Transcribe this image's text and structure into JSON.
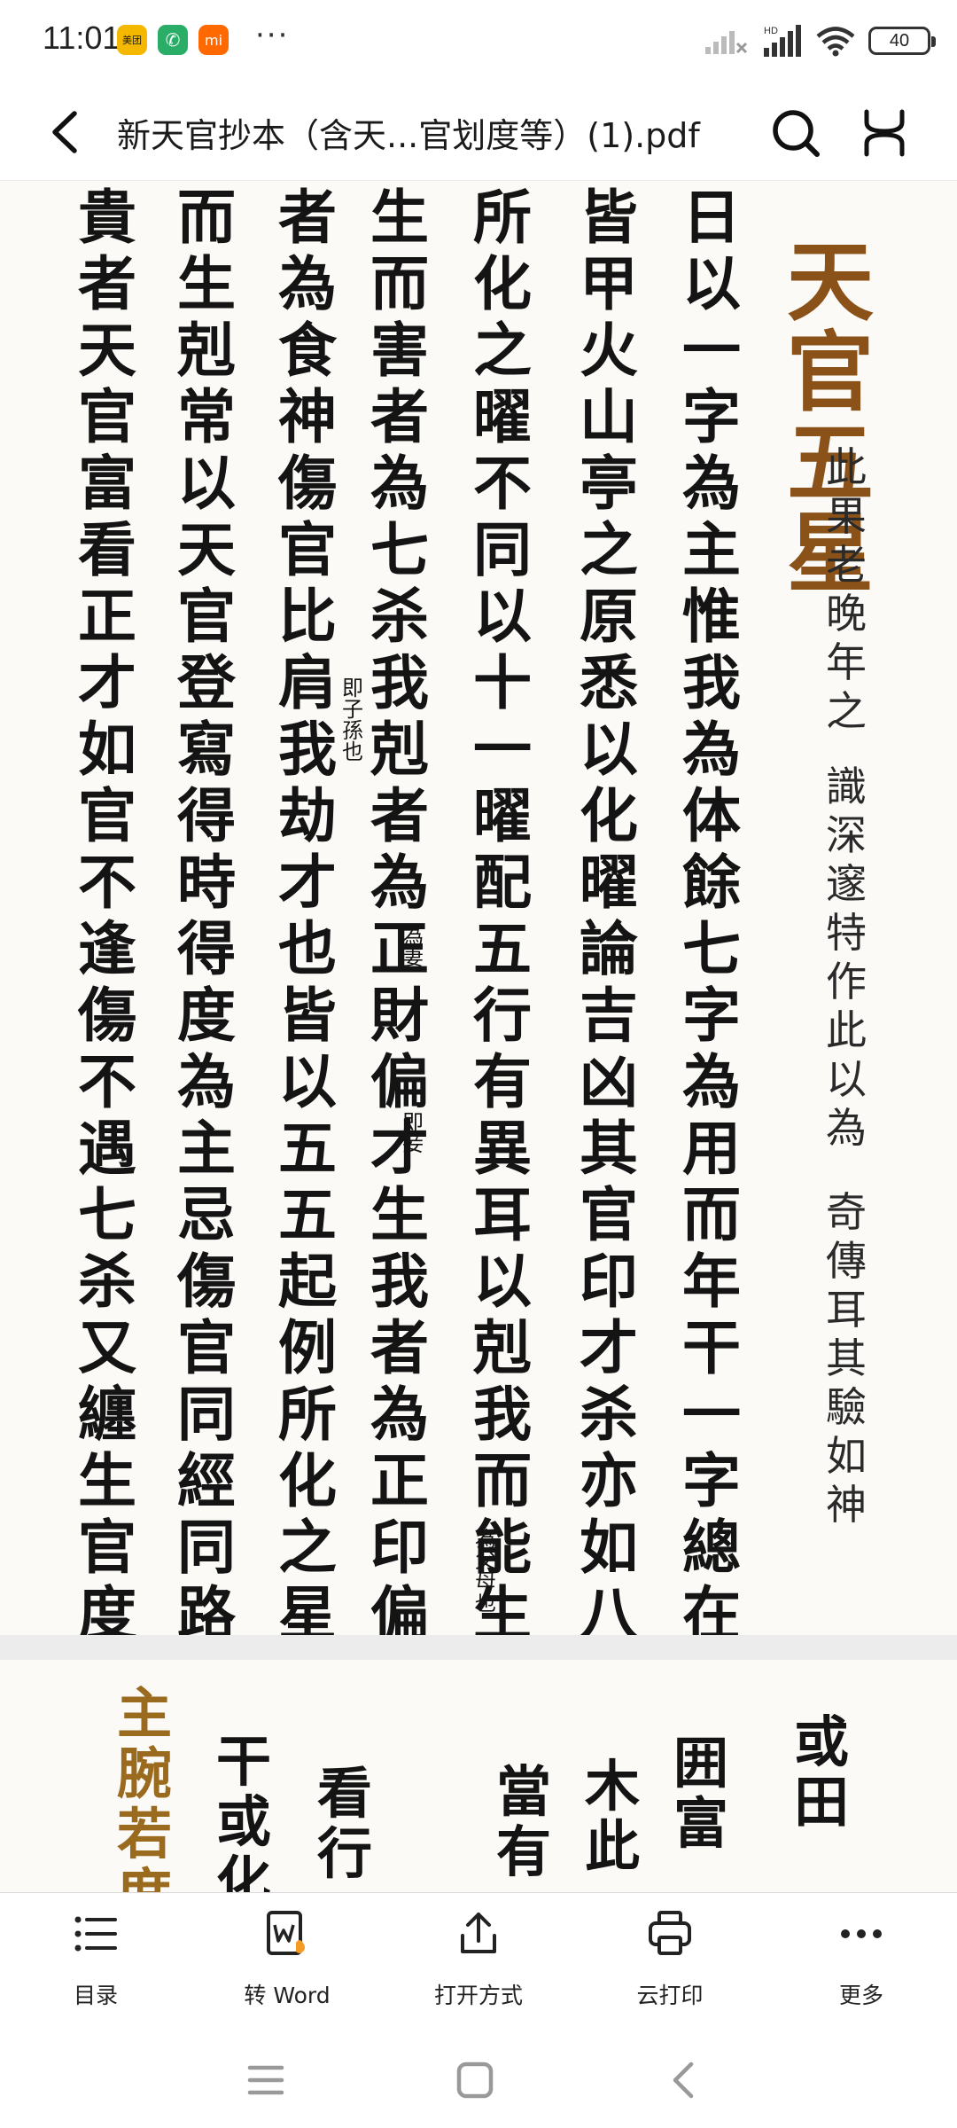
{
  "status_bar": {
    "time": "11:01",
    "apps": [
      {
        "name": "meituan-icon",
        "label": "美团",
        "color": "#f5b800"
      },
      {
        "name": "wechat-icon",
        "label": "✆",
        "color": "#2aae67"
      },
      {
        "name": "mi-icon",
        "label": "mi",
        "color": "#ff6900"
      }
    ],
    "more": "···",
    "battery": "40"
  },
  "header": {
    "title": "新天官抄本（含天...官划度等）(1).pdf"
  },
  "document": {
    "page1": {
      "title": "天官五星",
      "note_columns": [
        "此果老晚年之",
        "識深邃特作此以為",
        "奇傳耳其驗如神"
      ],
      "columns": [
        "日以一字為主惟我為体餘七字為用而年干一字總在十干化氣之",
        "皆甲火山亭之原悉以化曜論吉凶其官印才杀亦如八字起例但看",
        "所化之曜不同以十一曜配五行有異耳以剋我而能生我者為天官尊",
        "生而害者為七杀我剋者為正財偏才生我者為正印偏印我生",
        "者為食神傷官比肩我劫才也皆以五五起例所化之星不同即以化曜",
        "而生剋常以天官登寫得時得度為主忌傷官同經同路與失時失度",
        "貴者天官富看正才如官不逢傷不遇七杀又纏生官度上則貴可有"
      ],
      "small_notes": [
        "即子孫也",
        "為妻",
        "即妾",
        "為父母也"
      ]
    },
    "page2": {
      "columns": [
        "主腕若度",
        "干或化",
        "看行",
        "當有",
        "木此",
        "囲富",
        "或田"
      ]
    }
  },
  "toolbar": {
    "items": [
      {
        "label": "目录",
        "icon": "list-icon"
      },
      {
        "label": "转 Word",
        "icon": "convert-word-icon"
      },
      {
        "label": "打开方式",
        "icon": "share-icon"
      },
      {
        "label": "云打印",
        "icon": "printer-icon"
      },
      {
        "label": "更多",
        "icon": "more-icon"
      }
    ]
  },
  "accent_color": "#8a5218"
}
